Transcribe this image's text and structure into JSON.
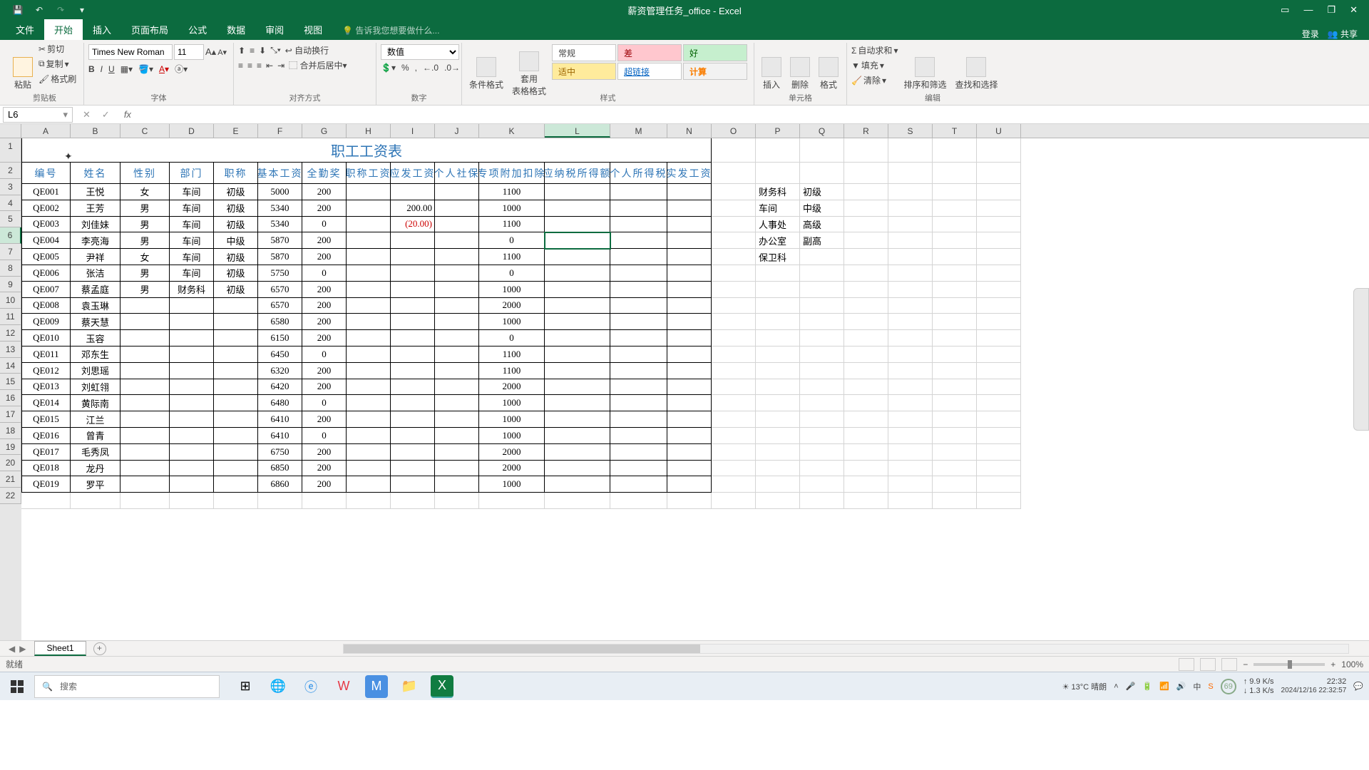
{
  "title_bar": {
    "app_title": "薪资管理任务_office - Excel"
  },
  "ribbon_tabs": {
    "file": "文件",
    "home": "开始",
    "insert": "插入",
    "layout": "页面布局",
    "formulas": "公式",
    "data": "数据",
    "review": "审阅",
    "view": "视图",
    "tell_me": "告诉我您想要做什么...",
    "login": "登录",
    "share": "共享"
  },
  "ribbon": {
    "clipboard": {
      "label": "剪贴板",
      "paste": "粘贴",
      "cut": "剪切",
      "copy": "复制",
      "painter": "格式刷"
    },
    "font": {
      "label": "字体",
      "name": "Times New Roman",
      "size": "11"
    },
    "align": {
      "label": "对齐方式",
      "wrap": "自动换行",
      "merge": "合并后居中"
    },
    "number": {
      "label": "数字",
      "format": "数值"
    },
    "styles": {
      "label": "样式",
      "cond": "条件格式",
      "table": "套用\n表格格式",
      "normal": "常规",
      "bad": "差",
      "good": "好",
      "neutral": "适中",
      "link": "超链接",
      "calc": "计算"
    },
    "cells": {
      "label": "单元格",
      "insert": "插入",
      "delete": "删除",
      "format": "格式"
    },
    "editing": {
      "label": "编辑",
      "sum": "自动求和",
      "fill": "填充",
      "clear": "清除",
      "sort": "排序和筛选",
      "find": "查找和选择"
    }
  },
  "formula": {
    "name_box": "L6"
  },
  "col_widths": {
    "A": 69,
    "B": 70,
    "C": 69,
    "D": 62,
    "E": 62,
    "F": 62,
    "G": 62,
    "H": 62,
    "I": 62,
    "J": 62,
    "K": 92,
    "L": 92,
    "M": 80,
    "N": 62,
    "O": 62,
    "P": 62,
    "Q": 62,
    "R": 62,
    "S": 62,
    "T": 62,
    "U": 62
  },
  "chart_data": {
    "type": "table",
    "title": "职工工资表",
    "headers": [
      "编号",
      "姓名",
      "性别",
      "部门",
      "职称",
      "基本工资",
      "全勤奖",
      "职称工资",
      "应发工资",
      "个人社保",
      "专项附加扣除",
      "应纳税所得额",
      "个人所得税",
      "实发工资"
    ],
    "rows": [
      [
        "QE001",
        "王悦",
        "女",
        "车间",
        "初级",
        "5000",
        "200",
        "",
        "",
        "",
        "1100",
        "",
        "",
        ""
      ],
      [
        "QE002",
        "王芳",
        "男",
        "车间",
        "初级",
        "5340",
        "200",
        "",
        "200.00",
        "",
        "1000",
        "",
        "",
        ""
      ],
      [
        "QE003",
        "刘佳妹",
        "男",
        "车间",
        "初级",
        "5340",
        "0",
        "",
        "(20.00)",
        "",
        "1100",
        "",
        "",
        ""
      ],
      [
        "QE004",
        "李亮海",
        "男",
        "车间",
        "中级",
        "5870",
        "200",
        "",
        "",
        "",
        "0",
        "",
        "",
        ""
      ],
      [
        "QE005",
        "尹祥",
        "女",
        "车间",
        "初级",
        "5870",
        "200",
        "",
        "",
        "",
        "1100",
        "",
        "",
        ""
      ],
      [
        "QE006",
        "张洁",
        "男",
        "车间",
        "初级",
        "5750",
        "0",
        "",
        "",
        "",
        "0",
        "",
        "",
        ""
      ],
      [
        "QE007",
        "蔡孟庭",
        "男",
        "财务科",
        "初级",
        "6570",
        "200",
        "",
        "",
        "",
        "1000",
        "",
        "",
        ""
      ],
      [
        "QE008",
        "袁玉琳",
        "",
        "",
        "",
        "6570",
        "200",
        "",
        "",
        "",
        "2000",
        "",
        "",
        ""
      ],
      [
        "QE009",
        "蔡天慧",
        "",
        "",
        "",
        "6580",
        "200",
        "",
        "",
        "",
        "1000",
        "",
        "",
        ""
      ],
      [
        "QE010",
        "玉容",
        "",
        "",
        "",
        "6150",
        "200",
        "",
        "",
        "",
        "0",
        "",
        "",
        ""
      ],
      [
        "QE011",
        "邓东生",
        "",
        "",
        "",
        "6450",
        "0",
        "",
        "",
        "",
        "1100",
        "",
        "",
        ""
      ],
      [
        "QE012",
        "刘思瑶",
        "",
        "",
        "",
        "6320",
        "200",
        "",
        "",
        "",
        "1100",
        "",
        "",
        ""
      ],
      [
        "QE013",
        "刘虹翎",
        "",
        "",
        "",
        "6420",
        "200",
        "",
        "",
        "",
        "2000",
        "",
        "",
        ""
      ],
      [
        "QE014",
        "黄际南",
        "",
        "",
        "",
        "6480",
        "0",
        "",
        "",
        "",
        "1000",
        "",
        "",
        ""
      ],
      [
        "QE015",
        "江兰",
        "",
        "",
        "",
        "6410",
        "200",
        "",
        "",
        "",
        "1000",
        "",
        "",
        ""
      ],
      [
        "QE016",
        "曾青",
        "",
        "",
        "",
        "6410",
        "0",
        "",
        "",
        "",
        "1000",
        "",
        "",
        ""
      ],
      [
        "QE017",
        "毛秀凤",
        "",
        "",
        "",
        "6750",
        "200",
        "",
        "",
        "",
        "2000",
        "",
        "",
        ""
      ],
      [
        "QE018",
        "龙丹",
        "",
        "",
        "",
        "6850",
        "200",
        "",
        "",
        "",
        "2000",
        "",
        "",
        ""
      ],
      [
        "QE019",
        "罗平",
        "",
        "",
        "",
        "6860",
        "200",
        "",
        "",
        "",
        "1000",
        "",
        "",
        ""
      ]
    ],
    "lookup": [
      [
        "财务科",
        "初级"
      ],
      [
        "车间",
        "中级"
      ],
      [
        "人事处",
        "高级"
      ],
      [
        "办公室",
        "副高"
      ],
      [
        "保卫科",
        ""
      ]
    ]
  },
  "sheet_tabs": {
    "s1": "Sheet1"
  },
  "status": {
    "ready": "就绪",
    "zoom": "100%"
  },
  "taskbar": {
    "search": "搜索",
    "weather": "13°C 晴朗",
    "net_up": "9.9 K/s",
    "net_dn": "1.3 K/s",
    "time": "22:32",
    "date": "2024/12/16 22:32:57",
    "ime": "中"
  }
}
